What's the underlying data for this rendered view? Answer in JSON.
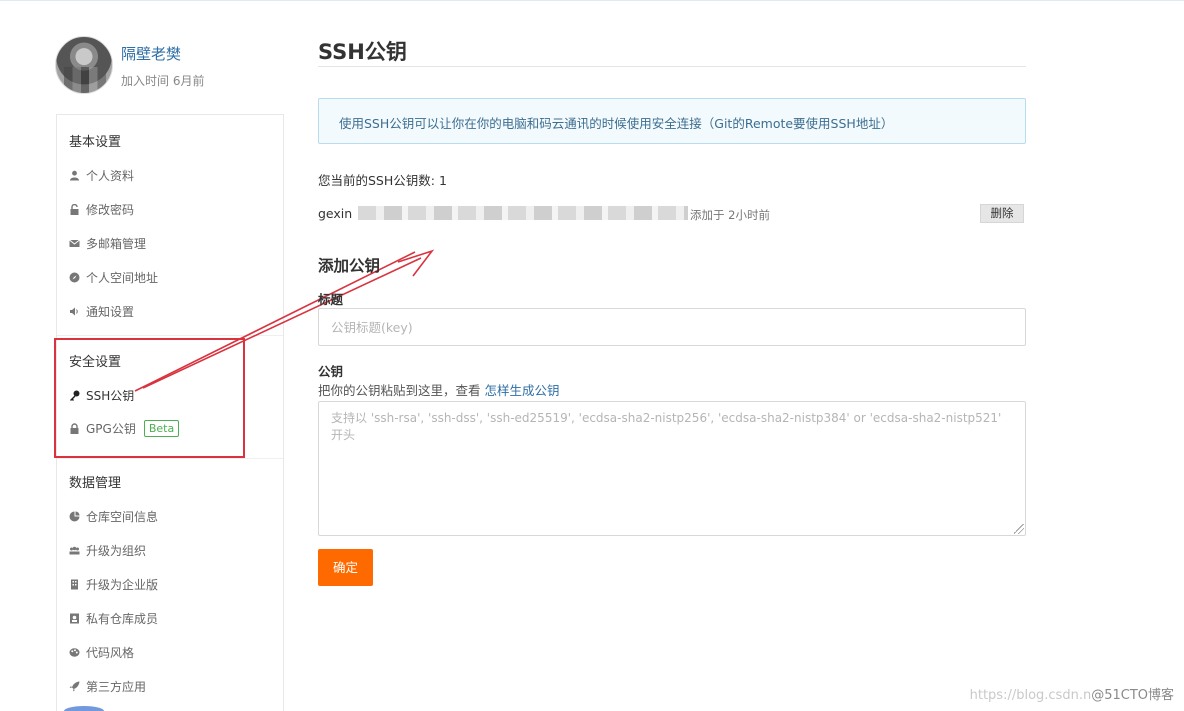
{
  "profile": {
    "name": "隔壁老樊",
    "joined": "加入时间 6月前"
  },
  "sidebar": {
    "sections": [
      {
        "title": "基本设置",
        "items": [
          {
            "label": "个人资料",
            "icon": "user-icon"
          },
          {
            "label": "修改密码",
            "icon": "lock-icon"
          },
          {
            "label": "多邮箱管理",
            "icon": "mail-icon"
          },
          {
            "label": "个人空间地址",
            "icon": "link-icon"
          },
          {
            "label": "通知设置",
            "icon": "speaker-icon"
          }
        ]
      },
      {
        "title": "安全设置",
        "items": [
          {
            "label": "SSH公钥",
            "icon": "key-icon"
          },
          {
            "label": "GPG公钥",
            "icon": "lock-icon",
            "badge": "Beta"
          }
        ]
      },
      {
        "title": "数据管理",
        "items": [
          {
            "label": "仓库空间信息",
            "icon": "pie-icon"
          },
          {
            "label": "升级为组织",
            "icon": "group-icon"
          },
          {
            "label": "升级为企业版",
            "icon": "building-icon"
          },
          {
            "label": "私有仓库成员",
            "icon": "member-icon"
          },
          {
            "label": "代码风格",
            "icon": "palette-icon"
          },
          {
            "label": "第三方应用",
            "icon": "rocket-icon"
          }
        ]
      }
    ]
  },
  "main": {
    "title": "SSH公钥",
    "notice": "使用SSH公钥可以让你在你的电脑和码云通讯的时候使用安全连接（Git的Remote要使用SSH地址）",
    "key_count": "您当前的SSH公钥数: 1",
    "key": {
      "name": "gexin",
      "added": "添加于 2小时前",
      "delete_label": "删除"
    },
    "add_heading": "添加公钥",
    "title_label": "标题",
    "title_placeholder": "公钥标题(key)",
    "key_label": "公钥",
    "key_hint": "把你的公钥粘贴到这里，查看 ",
    "key_hint_link": "怎样生成公钥",
    "key_placeholder": "支持以 'ssh-rsa', 'ssh-dss', 'ssh-ed25519', 'ecdsa-sha2-nistp256', 'ecdsa-sha2-nistp384' or 'ecdsa-sha2-nistp521' 开头",
    "submit_label": "确定"
  },
  "watermark": {
    "url": "https://blog.csdn.n",
    "brand": "@51CTO博客"
  },
  "colors": {
    "accent": "#ff6a00",
    "link": "#2e6ea6",
    "highlight": "#d9333f",
    "beta": "#4caf50"
  }
}
